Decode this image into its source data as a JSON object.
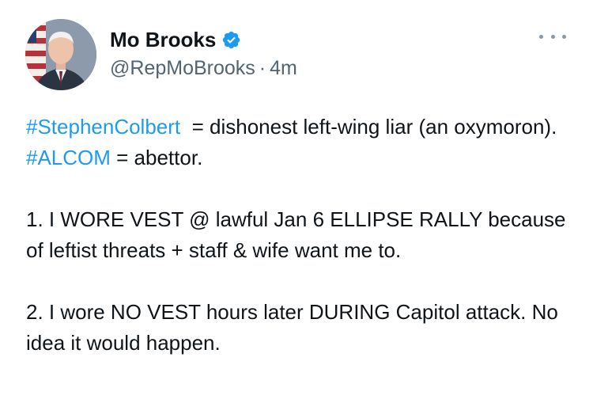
{
  "author": {
    "display_name": "Mo Brooks",
    "handle": "@RepMoBrooks",
    "separator": "·",
    "time": "4m",
    "verified": true,
    "avatar_icon": "profile-photo",
    "verified_icon": "verified-badge-icon",
    "more_icon": "more-options-icon"
  },
  "tweet": {
    "p1": {
      "hashtag1": "#StephenColbert",
      "text1": "  = dishonest left-wing liar (an oxymoron). ",
      "hashtag2": "#ALCOM",
      "text2": " = abettor."
    },
    "p2": "1. I WORE VEST @ lawful Jan 6 ELLIPSE RALLY because of leftist threats + staff & wife want me to.",
    "p3": "2. I wore NO VEST hours later DURING Capitol attack. No idea it would happen."
  },
  "colors": {
    "link": "#1d9bf0",
    "text": "#0f1419",
    "secondary": "#536471",
    "verified": "#1d9bf0"
  }
}
